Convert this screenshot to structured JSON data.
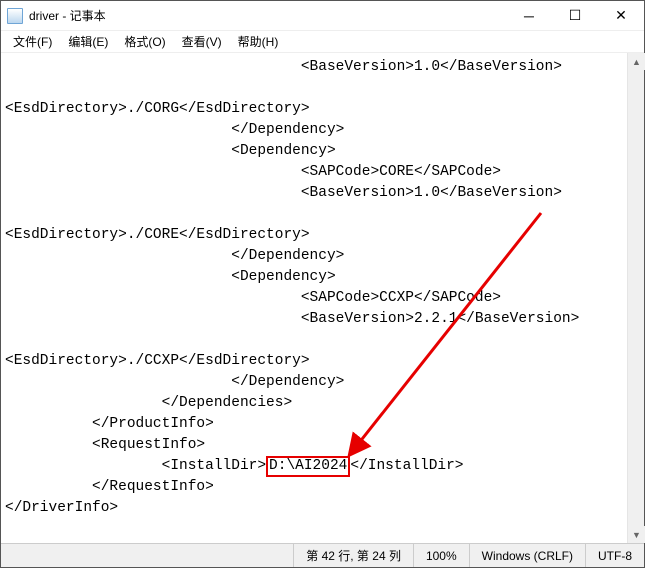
{
  "window": {
    "title": "driver - 记事本"
  },
  "menu": {
    "file": "文件(F)",
    "edit": "编辑(E)",
    "format": "格式(O)",
    "view": "查看(V)",
    "help": "帮助(H)"
  },
  "content": {
    "line1": "                                  <BaseVersion>1.0</BaseVersion>",
    "line2": "",
    "line3": "<EsdDirectory>./CORG</EsdDirectory>",
    "line4": "                          </Dependency>",
    "line5": "                          <Dependency>",
    "line6": "                                  <SAPCode>CORE</SAPCode>",
    "line7": "                                  <BaseVersion>1.0</BaseVersion>",
    "line8": "",
    "line9": "<EsdDirectory>./CORE</EsdDirectory>",
    "line10": "                          </Dependency>",
    "line11": "                          <Dependency>",
    "line12": "                                  <SAPCode>CCXP</SAPCode>",
    "line13": "                                  <BaseVersion>2.2.1</BaseVersion>",
    "line14": "",
    "line15": "<EsdDirectory>./CCXP</EsdDirectory>",
    "line16": "                          </Dependency>",
    "line17": "                  </Dependencies>",
    "line18": "          </ProductInfo>",
    "line19": "          <RequestInfo>",
    "line20a": "                  <InstallDir>",
    "line20b": "D:\\AI2024",
    "line20c": "</InstallDir>",
    "line21": "          </RequestInfo>",
    "line22": "</DriverInfo>"
  },
  "status": {
    "position": "第 42 行, 第 24 列",
    "zoom": "100%",
    "eol": "Windows (CRLF)",
    "encoding": "UTF-8"
  }
}
